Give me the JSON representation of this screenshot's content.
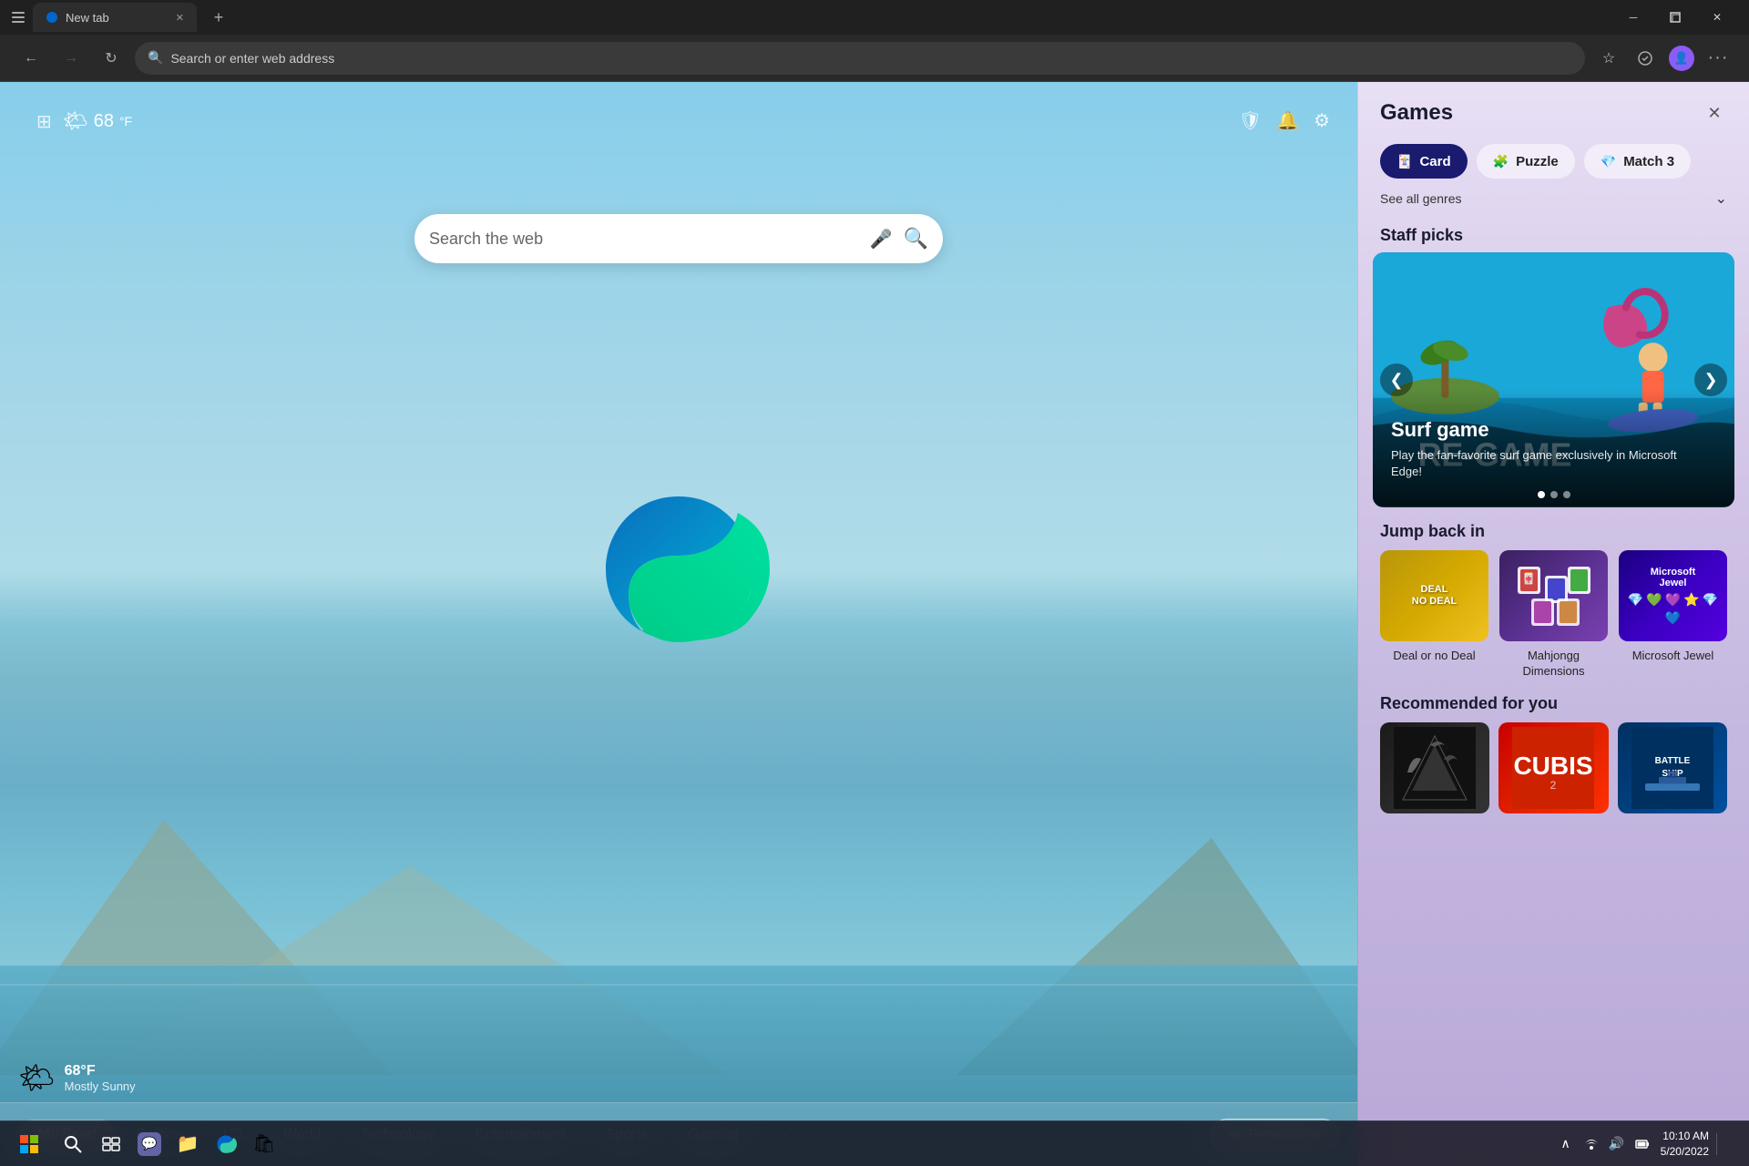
{
  "browser": {
    "tab_title": "New tab",
    "address_placeholder": "Search or enter web address",
    "tab_favicon": "🌐"
  },
  "newtab": {
    "weather_temp": "68",
    "weather_unit": "°F",
    "weather_icon": "🌤",
    "weather_temp_bottom": "68°F",
    "weather_desc": "Mostly Sunny",
    "search_placeholder": "Search the web",
    "nav_tabs": [
      "My Feed",
      "Politics",
      "US",
      "World",
      "Technology",
      "Entertainment",
      "Sports",
      "Gaming"
    ],
    "nav_active": "My Feed",
    "nav_more": "...",
    "personalize_label": "Personalize"
  },
  "games_sidebar": {
    "title": "Games",
    "genres": [
      {
        "id": "card",
        "label": "Card",
        "icon": "🃏",
        "active": true
      },
      {
        "id": "puzzle",
        "label": "Puzzle",
        "icon": "🧩",
        "active": false
      },
      {
        "id": "match3",
        "label": "Match 3",
        "icon": "💎",
        "active": false
      }
    ],
    "see_all_genres": "See all genres",
    "staff_picks_title": "Staff picks",
    "staff_pick_game": {
      "title": "Surf game",
      "description": "Play the fan-favorite surf game exclusively in Microsoft Edge!",
      "dots": 3,
      "active_dot": 0
    },
    "jump_back_title": "Jump back in",
    "jump_back_games": [
      {
        "name": "Deal or no Deal",
        "theme": "deal"
      },
      {
        "name": "Mahjongg Dimensions",
        "theme": "mah"
      },
      {
        "name": "Microsoft Jewel",
        "theme": "jewel"
      }
    ],
    "recommended_title": "Recommended for you",
    "recommended_games": [
      {
        "name": "Atari Game",
        "theme": "atari"
      },
      {
        "name": "Cubis 2",
        "theme": "cubis"
      },
      {
        "name": "Battleship",
        "theme": "battle"
      }
    ]
  },
  "taskbar": {
    "time": "10:10 AM",
    "date": "5/20/2022"
  },
  "icons": {
    "search": "🔍",
    "mic": "🎤",
    "settings": "⚙",
    "bell": "🔔",
    "shield": "🛡",
    "star": "⭐",
    "profile": "👤",
    "more": "···",
    "back": "←",
    "forward": "→",
    "refresh": "↻",
    "close_sidebar": "✕",
    "prev_arrow": "❮",
    "next_arrow": "❯",
    "chevron_down": "⌄",
    "pencil": "✏"
  }
}
